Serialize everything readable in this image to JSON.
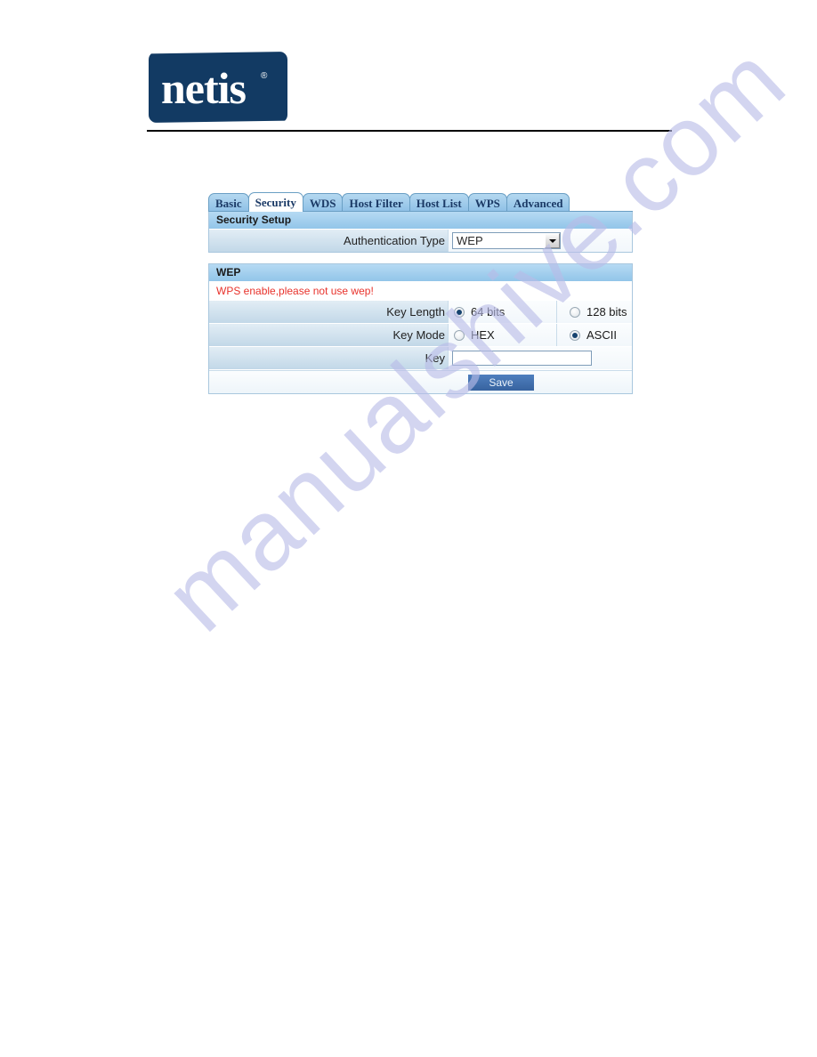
{
  "header": {
    "logo_text": "netis",
    "logo_registered": "®"
  },
  "tabs": [
    {
      "label": "Basic",
      "active": false
    },
    {
      "label": "Security",
      "active": true
    },
    {
      "label": "WDS",
      "active": false
    },
    {
      "label": "Host Filter",
      "active": false
    },
    {
      "label": "Host List",
      "active": false
    },
    {
      "label": "WPS",
      "active": false
    },
    {
      "label": "Advanced",
      "active": false
    }
  ],
  "security_setup": {
    "title": "Security Setup",
    "auth_type": {
      "label": "Authentication Type",
      "value": "WEP",
      "options": [
        "WEP"
      ]
    }
  },
  "wep": {
    "title": "WEP",
    "warning": "WPS enable,please not use wep!",
    "key_length": {
      "label": "Key Length",
      "option_a": "64 bits",
      "option_b": "128 bits",
      "selected": "64 bits"
    },
    "key_mode": {
      "label": "Key Mode",
      "option_a": "HEX",
      "option_b": "ASCII",
      "selected": "ASCII"
    },
    "key": {
      "label": "Key",
      "value": "",
      "placeholder": ""
    }
  },
  "actions": {
    "save_label": "Save"
  },
  "watermark": {
    "text": "manualshive.com"
  },
  "colors": {
    "logo_navy": "#123a63",
    "section_header": "#92c5e9",
    "tab_blue": "#8ec0e6",
    "warning_red": "#e8322b",
    "save_button": "#37639f"
  }
}
